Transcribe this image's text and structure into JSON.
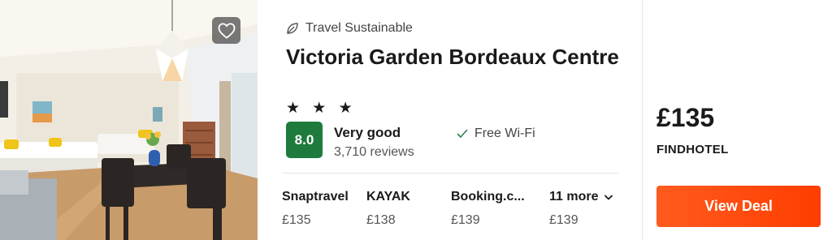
{
  "hotel": {
    "badge": "Travel Sustainable",
    "name": "Victoria Garden Bordeaux Centre",
    "stars": "★ ★ ★",
    "score": "8.0",
    "rating_label": "Very good",
    "reviews": "3,710 reviews",
    "amenity": "Free Wi-Fi"
  },
  "providers": [
    {
      "name": "Snaptravel",
      "price": "£135"
    },
    {
      "name": "KAYAK",
      "price": "£138"
    },
    {
      "name": "Booking.c...",
      "price": "£139"
    }
  ],
  "more": {
    "label": "11 more",
    "price": "£139"
  },
  "deal": {
    "price": "£135",
    "provider": "FINDHOTEL",
    "button": "View Deal"
  },
  "colors": {
    "score_bg": "#1f7a3d",
    "cta": "#ff4a0a"
  },
  "icons": {
    "favorite": "heart-icon",
    "sustainable": "leaf-icon",
    "amenity": "check-icon",
    "more": "chevron-down-icon"
  }
}
